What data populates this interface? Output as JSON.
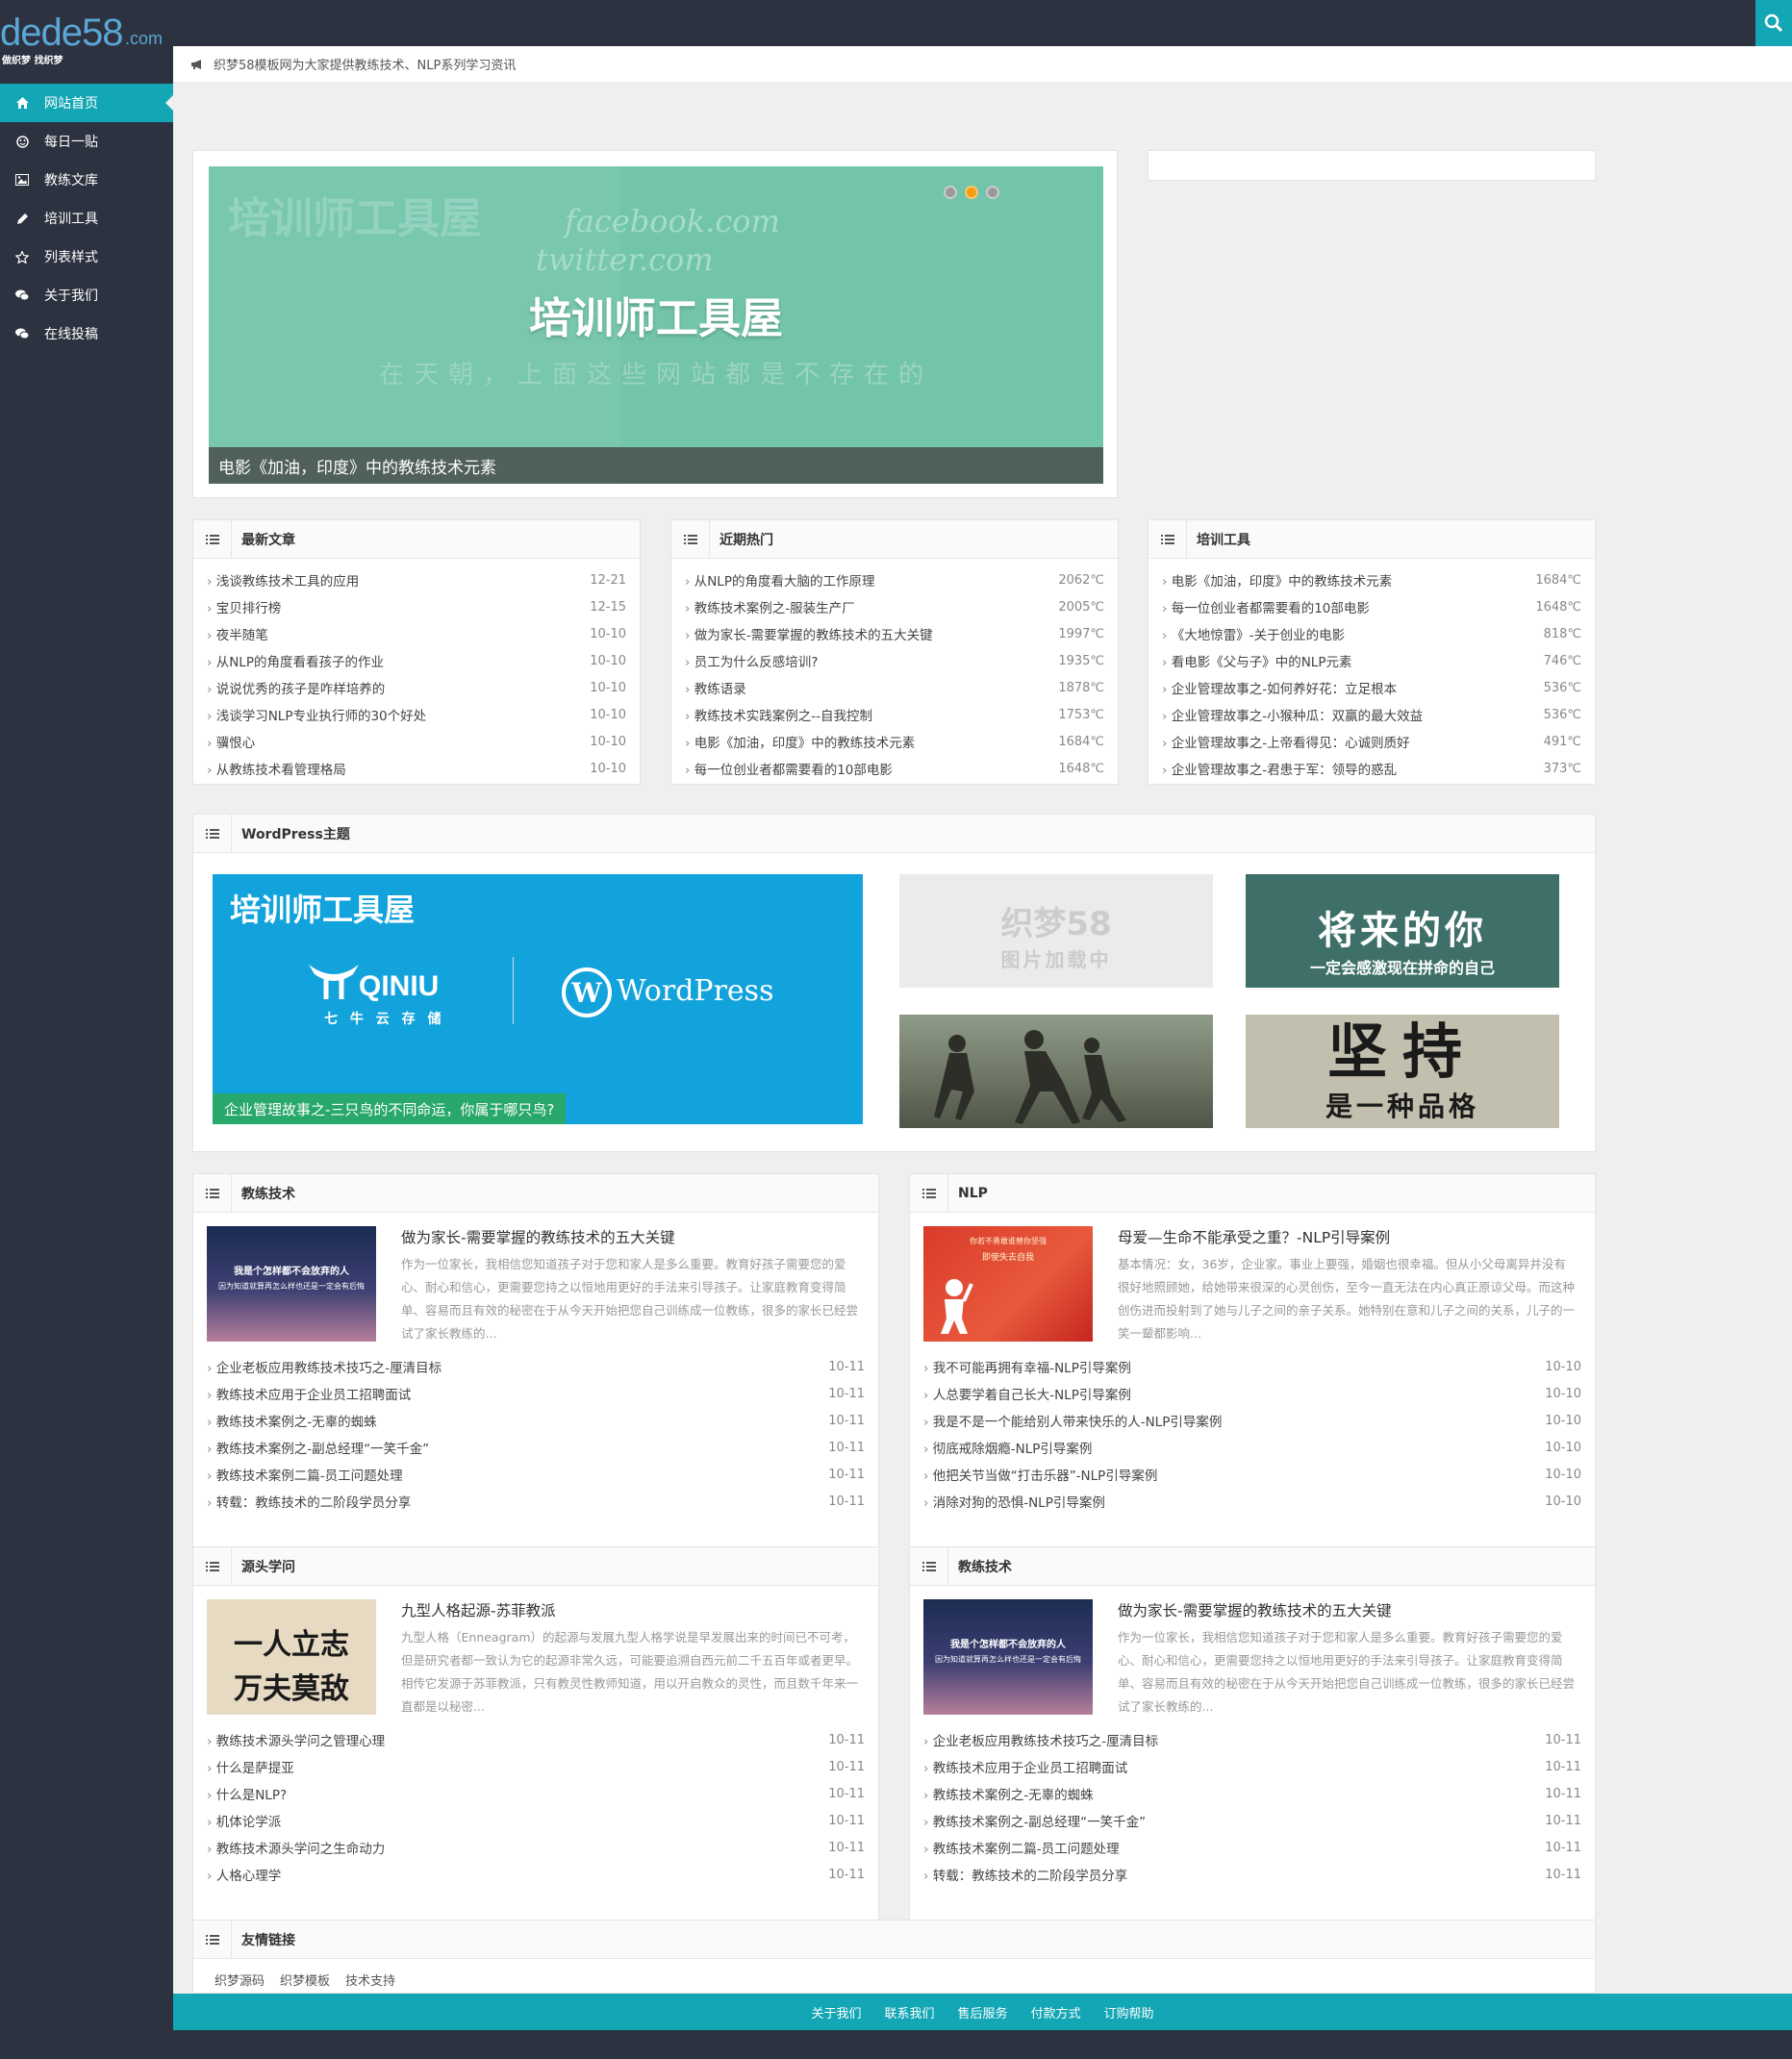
{
  "brand": {
    "logo_main": "dede58",
    "logo_suffix": ".com",
    "logo_sub": "做织梦 找织梦"
  },
  "colors": {
    "accent": "#13a6b4",
    "sidebar": "#2c323f",
    "content_bg": "#efefef",
    "dot_active": "#f39c12"
  },
  "header": {
    "search_icon": "search-icon"
  },
  "nav": [
    {
      "label": "网站首页",
      "icon": "home-icon"
    },
    {
      "label": "每日一贴",
      "icon": "smile-icon"
    },
    {
      "label": "教练文库",
      "icon": "image-icon"
    },
    {
      "label": "培训工具",
      "icon": "pencil-icon"
    },
    {
      "label": "列表样式",
      "icon": "star-icon"
    },
    {
      "label": "关于我们",
      "icon": "chat-icon"
    },
    {
      "label": "在线投稿",
      "icon": "chat-icon"
    }
  ],
  "notice": {
    "text": "织梦58模板网为大家提供教练技术、NLP系列学习资讯",
    "icon": "bullhorn-icon"
  },
  "slider": {
    "watermark": "培训师工具屋",
    "line1": "facebook.com",
    "line2": "twitter.com",
    "title": "培训师工具屋",
    "subtitle": "在天朝，上面这些网站都是不存在的",
    "caption": "电影《加油，印度》中的教练技术元素"
  },
  "latest": {
    "title": "最新文章",
    "items": [
      {
        "t": "浅谈教练技术工具的应用",
        "d": "12-21"
      },
      {
        "t": "宝贝排行榜",
        "d": "12-15"
      },
      {
        "t": "夜半随笔",
        "d": "10-10"
      },
      {
        "t": "从NLP的角度看看孩子的作业",
        "d": "10-10"
      },
      {
        "t": "说说优秀的孩子是咋样培养的",
        "d": "10-10"
      },
      {
        "t": "浅谈学习NLP专业执行师的30个好处",
        "d": "10-10"
      },
      {
        "t": "骥恨心",
        "d": "10-10"
      },
      {
        "t": "从教练技术看管理格局",
        "d": "10-10"
      }
    ]
  },
  "hot": {
    "title": "近期热门",
    "items": [
      {
        "t": "从NLP的角度看大脑的工作原理",
        "d": "2062℃"
      },
      {
        "t": "教练技术案例之-服装生产厂",
        "d": "2005℃"
      },
      {
        "t": "做为家长-需要掌握的教练技术的五大关键",
        "d": "1997℃"
      },
      {
        "t": "员工为什么反感培训?",
        "d": "1935℃"
      },
      {
        "t": "教练语录",
        "d": "1878℃"
      },
      {
        "t": "教练技术实践案例之--自我控制",
        "d": "1753℃"
      },
      {
        "t": "电影《加油，印度》中的教练技术元素",
        "d": "1684℃"
      },
      {
        "t": "每一位创业者都需要看的10部电影",
        "d": "1648℃"
      }
    ]
  },
  "tools": {
    "title": "培训工具",
    "items": [
      {
        "t": "电影《加油，印度》中的教练技术元素",
        "d": "1684℃"
      },
      {
        "t": "每一位创业者都需要看的10部电影",
        "d": "1648℃"
      },
      {
        "t": "《大地惊雷》-关于创业的电影",
        "d": "818℃"
      },
      {
        "t": "看电影《父与子》中的NLP元素",
        "d": "746℃"
      },
      {
        "t": "企业管理故事之-如何养好花：立足根本",
        "d": "536℃"
      },
      {
        "t": "企业管理故事之-小猴种瓜：双赢的最大效益",
        "d": "536℃"
      },
      {
        "t": "企业管理故事之-上帝看得见：心诚则质好",
        "d": "491℃"
      },
      {
        "t": "企业管理故事之-君患于军：领导的惑乱",
        "d": "373℃"
      }
    ]
  },
  "wordpress": {
    "title": "WordPress主题",
    "big_title": "培训师工具屋",
    "qiniu": "QINIU",
    "qiniu_sub": "七 牛 云 存 储",
    "wp": "WordPress",
    "big_caption": "企业管理故事之-三只鸟的不同命运，你属于哪只鸟?",
    "loading_line1": "织梦58",
    "loading_line2": "图片加载中",
    "future_line1": "将来的你",
    "future_line2": "一定会感激现在拼命的自己",
    "persist_line1": "坚持",
    "persist_line2": "是一种品格"
  },
  "coach1": {
    "title": "教练技术",
    "feature_title": "做为家长-需要掌握的教练技术的五大关键",
    "feature_desc": "作为一位家长，我相信您知道孩子对于您和家人是多么重要。教育好孩子需要您的爱心、耐心和信心，更需要您持之以恒地用更好的手法来引导孩子。让家庭教育变得简单、容易而且有效的秘密在于从今天开始把您自己训练成一位教练，很多的家长已经尝试了家长教练的...",
    "thumb_text1": "我是个怎样都不会放弃的人",
    "thumb_text2": "因为知道就算再怎么样也还是一定会有后悔",
    "items": [
      {
        "t": "企业老板应用教练技术技巧之-厘清目标",
        "d": "10-11"
      },
      {
        "t": "教练技术应用于企业员工招聘面试",
        "d": "10-11"
      },
      {
        "t": "教练技术案例之-无辜的蜘蛛",
        "d": "10-11"
      },
      {
        "t": "教练技术案例之-副总经理“一笑千金”",
        "d": "10-11"
      },
      {
        "t": "教练技术案例二篇-员工问题处理",
        "d": "10-11"
      },
      {
        "t": "转载：教练技术的二阶段学员分享",
        "d": "10-11"
      }
    ]
  },
  "nlp": {
    "title": "NLP",
    "feature_title": "母爱—生命不能承受之重？-NLP引导案例",
    "feature_desc": "基本情况：女，36岁，企业家。事业上要强，婚姻也很幸福。但从小父母离异并没有很好地照顾她，给她带来很深的心灵创伤，至今一直无法在内心真正原谅父母。而这种创伤进而投射到了她与儿子之间的亲子关系。她特别在意和儿子之间的关系，儿子的一笑一颦都影响...",
    "thumb_text1": "你若不勇敢谁替你坚强",
    "thumb_text2": "即使失去自我",
    "items": [
      {
        "t": "我不可能再拥有幸福-NLP引导案例",
        "d": "10-10"
      },
      {
        "t": "人总要学着自己长大-NLP引导案例",
        "d": "10-10"
      },
      {
        "t": "我是不是一个能给别人带来快乐的人-NLP引导案例",
        "d": "10-10"
      },
      {
        "t": "彻底戒除烟瘾-NLP引导案例",
        "d": "10-10"
      },
      {
        "t": "他把关节当做“打击乐器”-NLP引导案例",
        "d": "10-10"
      },
      {
        "t": "消除对狗的恐惧-NLP引导案例",
        "d": "10-10"
      }
    ]
  },
  "source": {
    "title": "源头学问",
    "feature_title": "九型人格起源-苏菲教派",
    "feature_desc": "九型人格（Enneagram）的起源与发展九型人格学说是早发展出来的时间已不可考，但是研究者都一致认为它的起源非常久远，可能要追溯自西元前二千五百年或者更早。相传它发源于苏菲教派，只有教灵性教师知道，用以开启教众的灵性，而且数千年来一直都是以秘密...",
    "thumb_text1": "一人立志",
    "thumb_text2": "万夫莫敌",
    "items": [
      {
        "t": "教练技术源头学问之管理心理",
        "d": "10-11"
      },
      {
        "t": "什么是萨提亚",
        "d": "10-11"
      },
      {
        "t": "什么是NLP?",
        "d": "10-11"
      },
      {
        "t": "机体论学派",
        "d": "10-11"
      },
      {
        "t": "教练技术源头学问之生命动力",
        "d": "10-11"
      },
      {
        "t": "人格心理学",
        "d": "10-11"
      }
    ]
  },
  "coach2": {
    "title": "教练技术",
    "feature_title": "做为家长-需要掌握的教练技术的五大关键",
    "feature_desc": "作为一位家长，我相信您知道孩子对于您和家人是多么重要。教育好孩子需要您的爱心、耐心和信心，更需要您持之以恒地用更好的手法来引导孩子。让家庭教育变得简单、容易而且有效的秘密在于从今天开始把您自己训练成一位教练，很多的家长已经尝试了家长教练的...",
    "thumb_text1": "我是个怎样都不会放弃的人",
    "thumb_text2": "因为知道就算再怎么样也还是一定会有后悔",
    "items": [
      {
        "t": "企业老板应用教练技术技巧之-厘清目标",
        "d": "10-11"
      },
      {
        "t": "教练技术应用于企业员工招聘面试",
        "d": "10-11"
      },
      {
        "t": "教练技术案例之-无辜的蜘蛛",
        "d": "10-11"
      },
      {
        "t": "教练技术案例之-副总经理“一笑千金”",
        "d": "10-11"
      },
      {
        "t": "教练技术案例二篇-员工问题处理",
        "d": "10-11"
      },
      {
        "t": "转载：教练技术的二阶段学员分享",
        "d": "10-11"
      }
    ]
  },
  "friends": {
    "title": "友情链接",
    "items": [
      "织梦源码",
      "织梦模板",
      "技术支持"
    ]
  },
  "footer": {
    "items": [
      "关于我们",
      "联系我们",
      "售后服务",
      "付款方式",
      "订购帮助"
    ]
  }
}
